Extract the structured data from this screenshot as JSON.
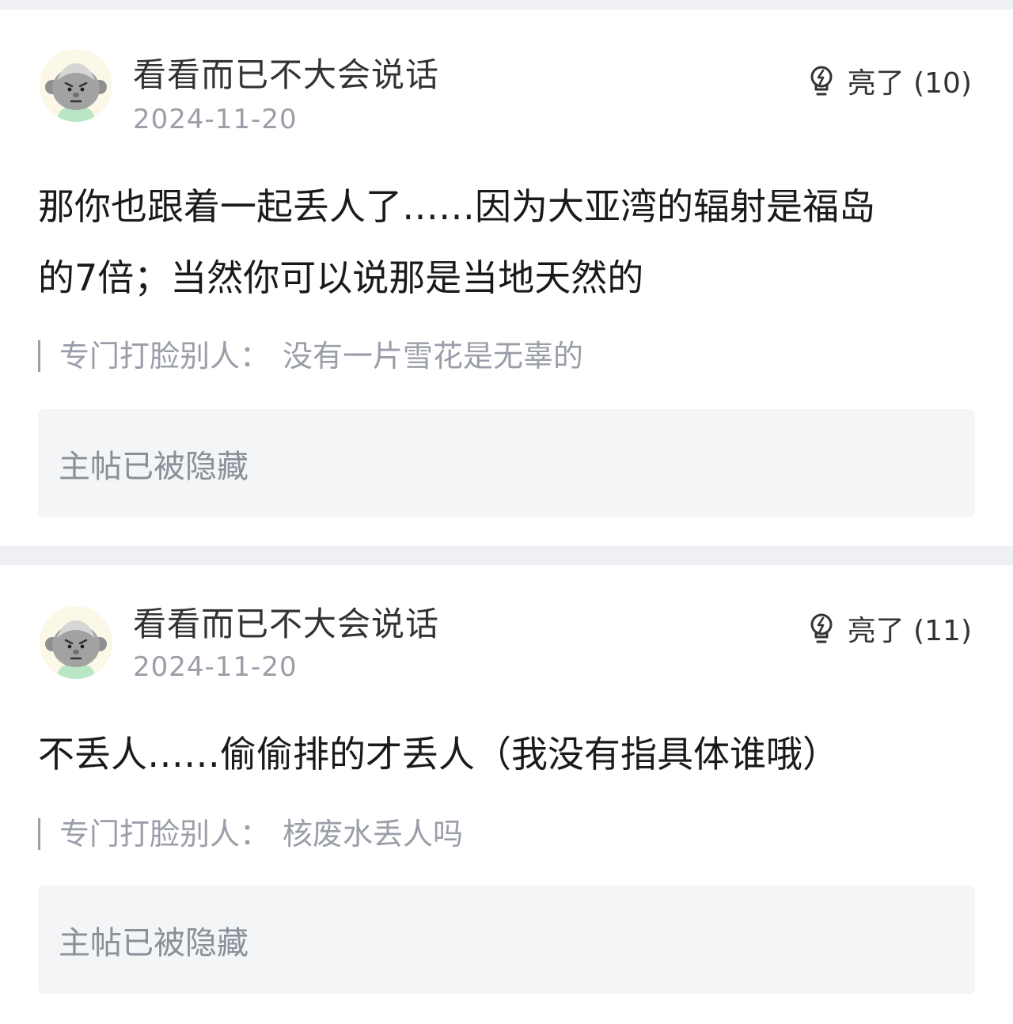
{
  "replies": [
    {
      "username": "看看而已不大会说话",
      "date": "2024-11-20",
      "light_label": "亮了 (10)",
      "content": "那你也跟着一起丢人了……因为大亚湾的辐射是福岛的7倍；当然你可以说那是当地天然的",
      "quote_user": "专门打脸别人：",
      "quote_text": "没有一片雪花是无辜的",
      "hidden_notice": "主帖已被隐藏"
    },
    {
      "username": "看看而已不大会说话",
      "date": "2024-11-20",
      "light_label": "亮了 (11)",
      "content": "不丢人……偷偷排的才丢人（我没有指具体谁哦）",
      "quote_user": "专门打脸别人：",
      "quote_text": "核废水丢人吗",
      "hidden_notice": "主帖已被隐藏"
    }
  ],
  "icons": {
    "avatar": "grumpy-face-avatar",
    "light": "lightbulb-icon"
  },
  "colors": {
    "page_background": "#eef0f3",
    "card_background": "#ffffff",
    "hidden_box_background": "#f3f5f7",
    "muted_text": "#9a9ea8",
    "avatar_shirt": "#b9e6c5"
  }
}
